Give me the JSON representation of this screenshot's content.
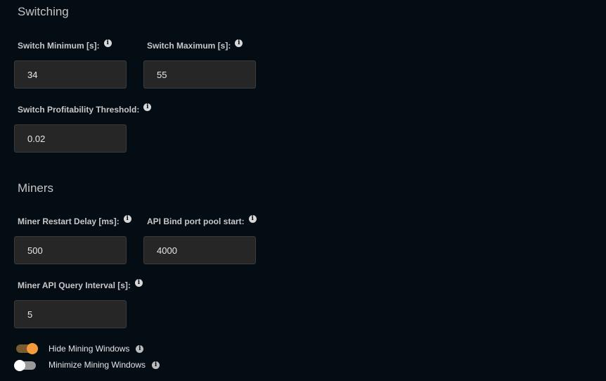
{
  "switching": {
    "title": "Switching",
    "switch_min": {
      "label": "Switch Minimum [s]:",
      "value": "34"
    },
    "switch_max": {
      "label": "Switch Maximum [s]:",
      "value": "55"
    },
    "threshold": {
      "label": "Switch Profitability Threshold:",
      "value": "0.02"
    }
  },
  "miners": {
    "title": "Miners",
    "restart_delay": {
      "label": "Miner Restart Delay [ms]:",
      "value": "500"
    },
    "api_port": {
      "label": "API Bind port pool start:",
      "value": "4000"
    },
    "query_interval": {
      "label": "Miner API Query Interval [s]:",
      "value": "5"
    },
    "hide_windows": {
      "label": "Hide Mining Windows",
      "on": true
    },
    "minimize_windows": {
      "label": "Minimize Mining Windows",
      "on": false
    }
  },
  "info_glyph": "i",
  "colors": {
    "accent": "#f49b3b",
    "background": "#040c14",
    "input": "#262626"
  }
}
